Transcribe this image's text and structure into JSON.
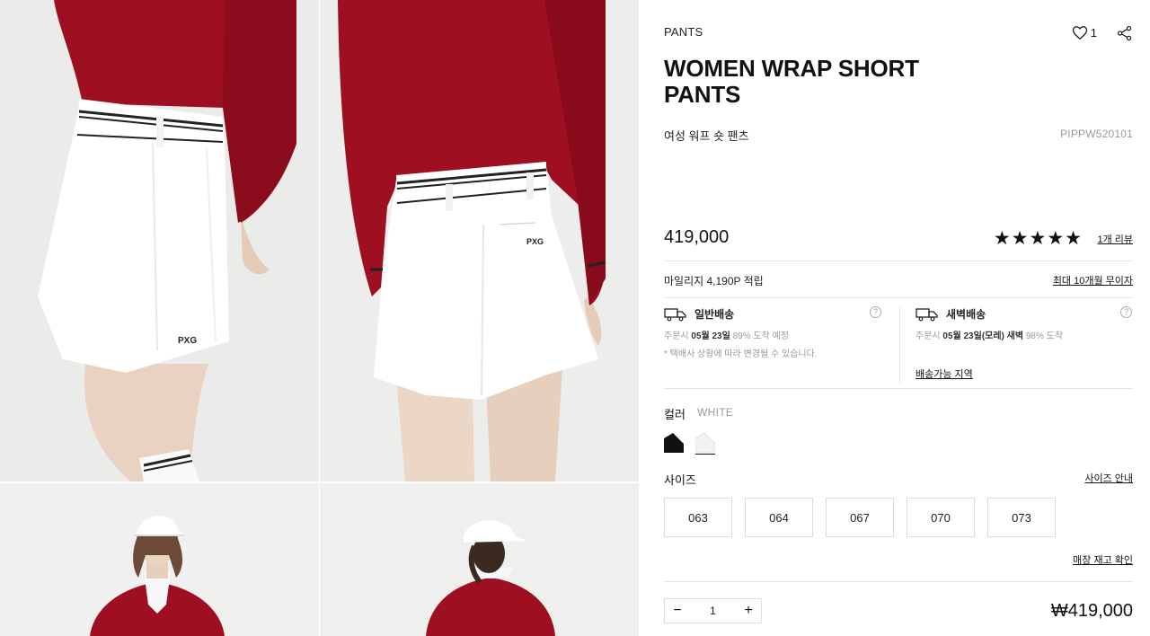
{
  "product": {
    "category": "PANTS",
    "title": "WOMEN WRAP SHORT PANTS",
    "subtitle": "여성 워프 숏 팬츠",
    "code": "PIPPW520101",
    "like_count": "1",
    "price": "419,000",
    "rating_stars": "★★★★★",
    "review_link": "1개 리뷰"
  },
  "mileage": {
    "text": "마일리지 4,190P 적립",
    "installment_link": "최대 10개월 무이자"
  },
  "shipping": {
    "normal": {
      "title": "일반배송",
      "line_prefix": "주문시",
      "date": "05월 23일",
      "rate": "89% 도착 예정",
      "note": "* 택배사 상황에 따라 변경될 수 있습니다."
    },
    "dawn": {
      "title": "새벽배송",
      "line_prefix": "주문시",
      "date": "05월 23일(모레) 새벽",
      "rate": "98% 도착",
      "area_link": "배송가능 지역"
    },
    "help_glyph": "?"
  },
  "options": {
    "color_label": "컬러",
    "color_value": "WHITE",
    "swatches": [
      "black",
      "white"
    ],
    "size_label": "사이즈",
    "size_guide_link": "사이즈 안내",
    "sizes": [
      "063",
      "064",
      "067",
      "070",
      "073"
    ],
    "stock_link": "매장 재고 확인"
  },
  "purchase": {
    "minus": "−",
    "quantity": "1",
    "plus": "+",
    "total": "₩419,000"
  },
  "icons": {
    "wish": "heart-icon",
    "share": "share-icon",
    "truck": "truck-icon",
    "help": "question-icon"
  },
  "colors": {
    "shirt": "#9e0f21",
    "shorts": "#ffffff",
    "photo_bg": "#ebebea",
    "text": "#111111",
    "muted": "#999999",
    "border": "#dcdcdc"
  }
}
